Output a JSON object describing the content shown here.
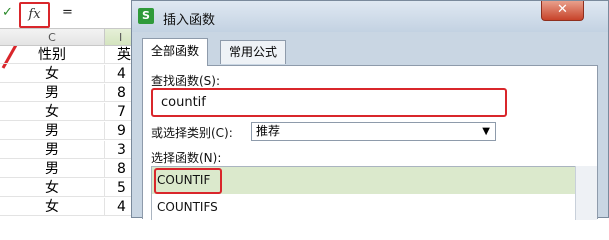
{
  "formula_bar": {
    "check_icon": "check-icon",
    "fx_label": "fx",
    "equals": "="
  },
  "sheet": {
    "col_c_header": "C",
    "col_d_header": "I",
    "rows": [
      {
        "c": "性别",
        "d": "英"
      },
      {
        "c": "女",
        "d": "4"
      },
      {
        "c": "男",
        "d": "8"
      },
      {
        "c": "女",
        "d": "7"
      },
      {
        "c": "男",
        "d": "9"
      },
      {
        "c": "男",
        "d": "3"
      },
      {
        "c": "男",
        "d": "8"
      },
      {
        "c": "女",
        "d": "5"
      },
      {
        "c": "女",
        "d": "4"
      }
    ]
  },
  "dialog": {
    "icon_letter": "S",
    "title": "插入函数",
    "close_label": "✕",
    "tabs": [
      {
        "label": "全部函数"
      },
      {
        "label": "常用公式"
      }
    ],
    "search_label": "查找函数(S):",
    "search_value": "countif",
    "category_label": "或选择类别(C):",
    "category_value": "推荐",
    "list_label": "选择函数(N):",
    "functions": [
      "COUNTIF",
      "COUNTIFS"
    ]
  },
  "colors": {
    "highlight_red": "#d9262b",
    "selected_row": "#dbe9cc"
  }
}
